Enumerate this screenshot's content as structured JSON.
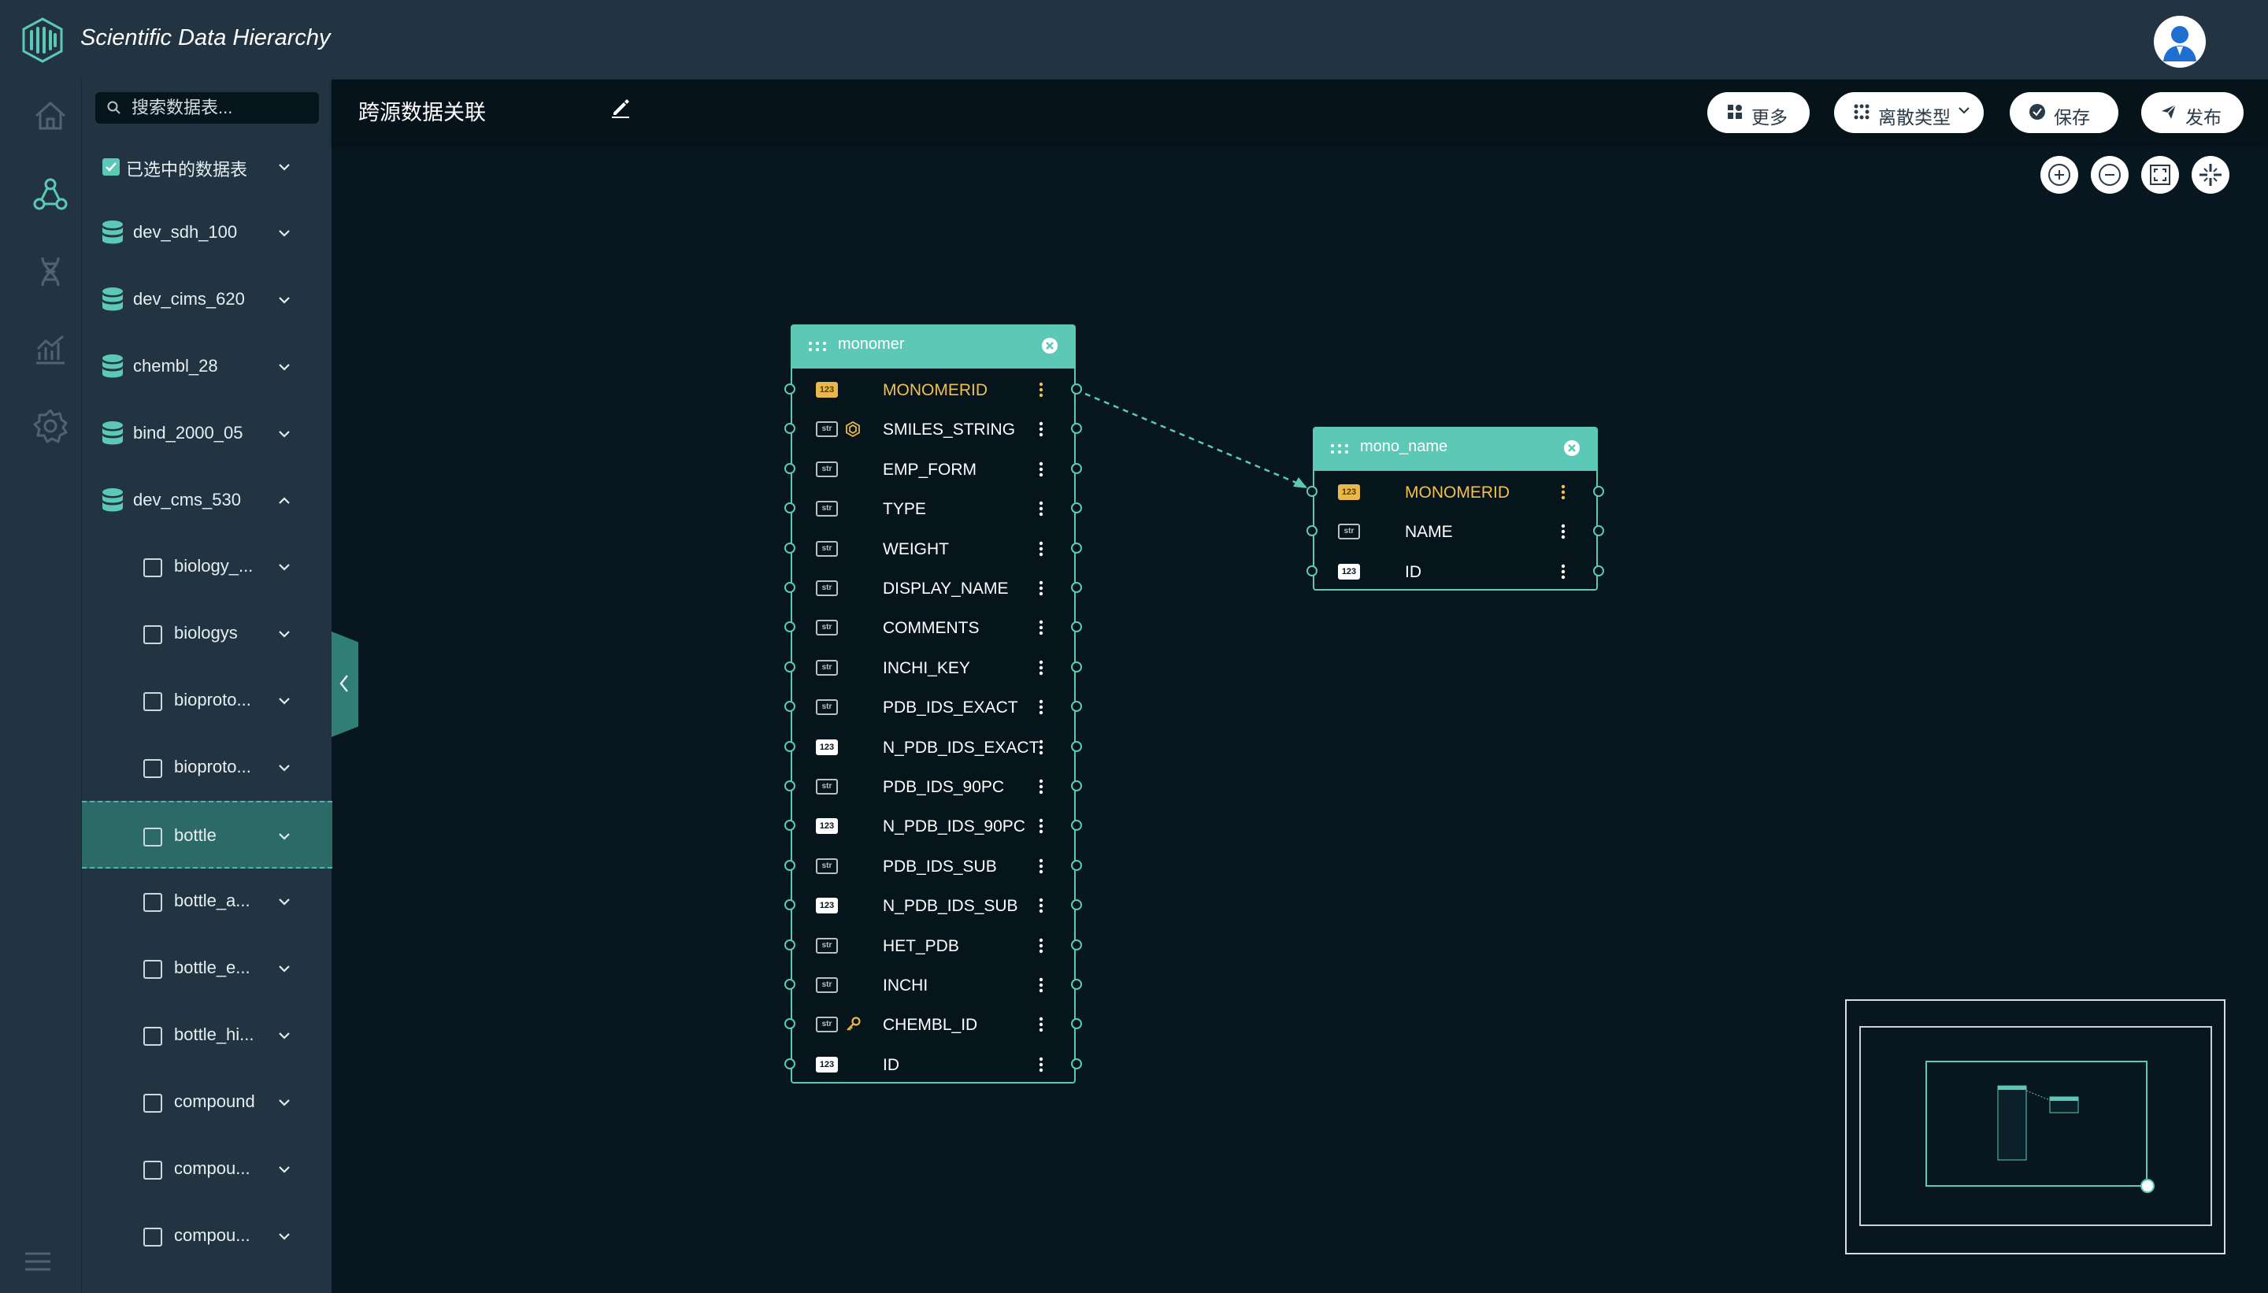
{
  "app": {
    "title": "Scientific Data Hierarchy"
  },
  "sidebar": {
    "search_placeholder": "搜索数据表...",
    "selected_group_label": "已选中的数据表",
    "databases": [
      "dev_sdh_100",
      "dev_cims_620",
      "chembl_28",
      "bind_2000_05",
      "dev_cms_530"
    ],
    "tables": [
      "biology_...",
      "biologys",
      "bioproto...",
      "bioproto...",
      "bottle",
      "bottle_a...",
      "bottle_e...",
      "bottle_hi...",
      "compound",
      "compou...",
      "compou..."
    ],
    "selected_table": "bottle"
  },
  "header": {
    "title": "跨源数据关联",
    "more_label": "更多",
    "type_select_value": "离散类型",
    "save_label": "保存",
    "publish_label": "发布"
  },
  "entities": [
    {
      "name": "monomer",
      "fields": [
        {
          "name": "MONOMERID",
          "type": "123",
          "primary": true
        },
        {
          "name": "SMILES_STRING",
          "type": "str",
          "extra": "hexagon-icon"
        },
        {
          "name": "EMP_FORM",
          "type": "str"
        },
        {
          "name": "TYPE",
          "type": "str"
        },
        {
          "name": "WEIGHT",
          "type": "str"
        },
        {
          "name": "DISPLAY_NAME",
          "type": "str"
        },
        {
          "name": "COMMENTS",
          "type": "str"
        },
        {
          "name": "INCHI_KEY",
          "type": "str"
        },
        {
          "name": "PDB_IDS_EXACT",
          "type": "str"
        },
        {
          "name": "N_PDB_IDS_EXACT",
          "type": "123"
        },
        {
          "name": "PDB_IDS_90PC",
          "type": "str"
        },
        {
          "name": "N_PDB_IDS_90PC",
          "type": "123"
        },
        {
          "name": "PDB_IDS_SUB",
          "type": "str"
        },
        {
          "name": "N_PDB_IDS_SUB",
          "type": "123"
        },
        {
          "name": "HET_PDB",
          "type": "str"
        },
        {
          "name": "INCHI",
          "type": "str"
        },
        {
          "name": "CHEMBL_ID",
          "type": "str",
          "extra": "key-icon"
        },
        {
          "name": "ID",
          "type": "123"
        }
      ]
    },
    {
      "name": "mono_name",
      "fields": [
        {
          "name": "MONOMERID",
          "type": "123",
          "primary": true
        },
        {
          "name": "NAME",
          "type": "str"
        },
        {
          "name": "ID",
          "type": "123"
        }
      ]
    }
  ],
  "relation": {
    "from": "monomer.MONOMERID",
    "to": "mono_name.MONOMERID"
  },
  "colors": {
    "accent": "#5cc9b6",
    "background": "#07161f",
    "panel": "#223441",
    "primary_key": "#f3c04e"
  }
}
